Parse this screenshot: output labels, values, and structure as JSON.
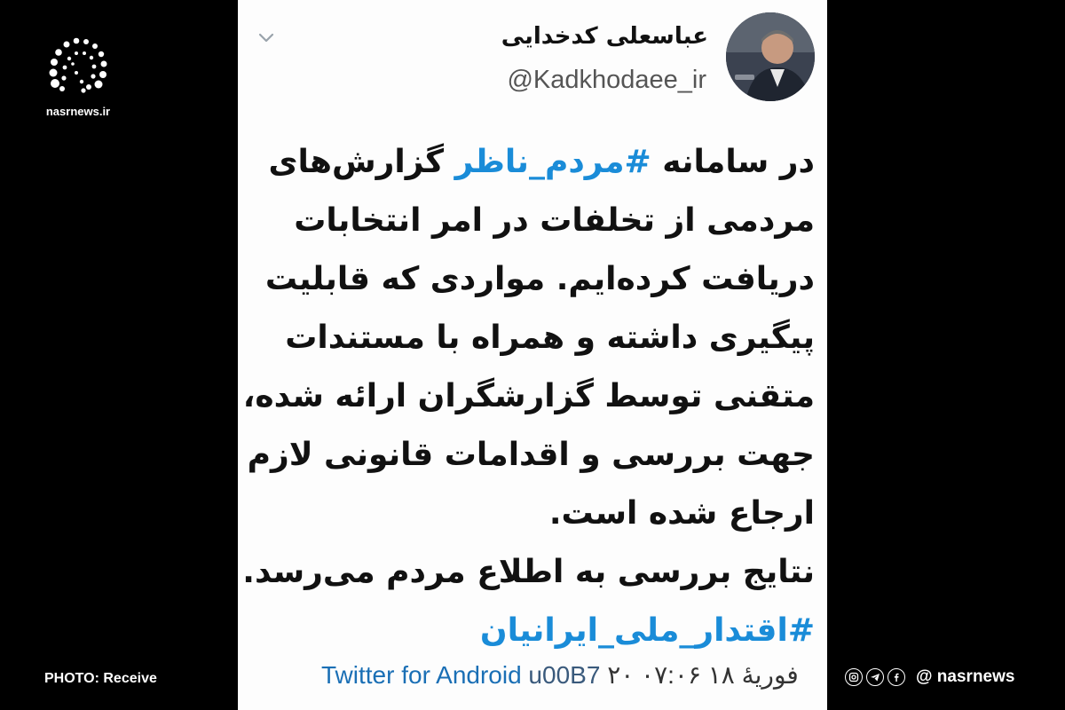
{
  "brand": {
    "domain": "nasrnews.ir",
    "logo_icon": "nasr-logo-icon"
  },
  "tweet": {
    "author_name": "عباسعلی کدخدایی",
    "handle": "@Kadkhodaee_ir",
    "avatar_icon": "avatar",
    "menu_icon": "chevron-down-icon",
    "body": {
      "l1_prefix": "در سامانه ",
      "l1_hashtag": "#مردم_ناظر",
      "l1_suffix": " گزارش‌های",
      "l2": "مردمی از تخلفات در امر انتخابات",
      "l3": "دریافت کرده‌ایم. مواردی که قابلیت",
      "l4": "پیگیری داشته و همراه با مستندات",
      "l5": "متقنی توسط گزارشگران ارائه شده،",
      "l6": "جهت بررسی و اقدامات قانونی لازم",
      "l7": "ارجاع شده است.",
      "l8": "نتایج بررسی به اطلاع مردم می‌رسد.",
      "l9_hashtag": "#اقتدار_ملی_ایرانیان"
    },
    "meta": {
      "client": "Twitter for Android",
      "separator": " u00B7 ",
      "date": "۲۰ فوریهٔ ۱۸ ۰۷:۰۶"
    }
  },
  "footer": {
    "photo_credit": "PHOTO: Receive",
    "social_handle": "@ nasrnews",
    "social_icons": [
      "instagram-icon",
      "telegram-icon",
      "facebook-icon"
    ]
  },
  "colors": {
    "background": "#000000",
    "card": "#fdfdfd",
    "hashtag": "#1a8cd8",
    "client_link": "#1a6fb5"
  }
}
